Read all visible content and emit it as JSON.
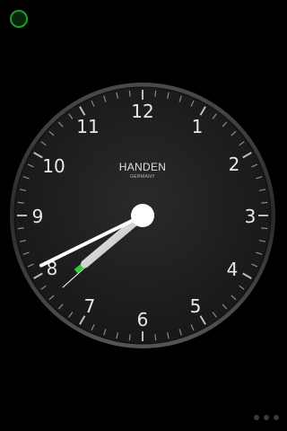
{
  "clock": {
    "brand": "HANDEN",
    "origin": "GERMANY",
    "numbers": [
      "12",
      "1",
      "2",
      "3",
      "4",
      "5",
      "6",
      "7",
      "8",
      "9",
      "10",
      "11"
    ],
    "time": {
      "hour": 7,
      "minute": 40,
      "second": 38
    },
    "colors": {
      "face": "#1c1c1c",
      "bezel": "#3a3a3a",
      "hands": "#ffffff",
      "hour_hand": "#d0d0d0",
      "accent": "#35c93a"
    }
  },
  "status_indicator": {
    "color": "#1f9a2a"
  },
  "pager": {
    "dots": 3
  }
}
